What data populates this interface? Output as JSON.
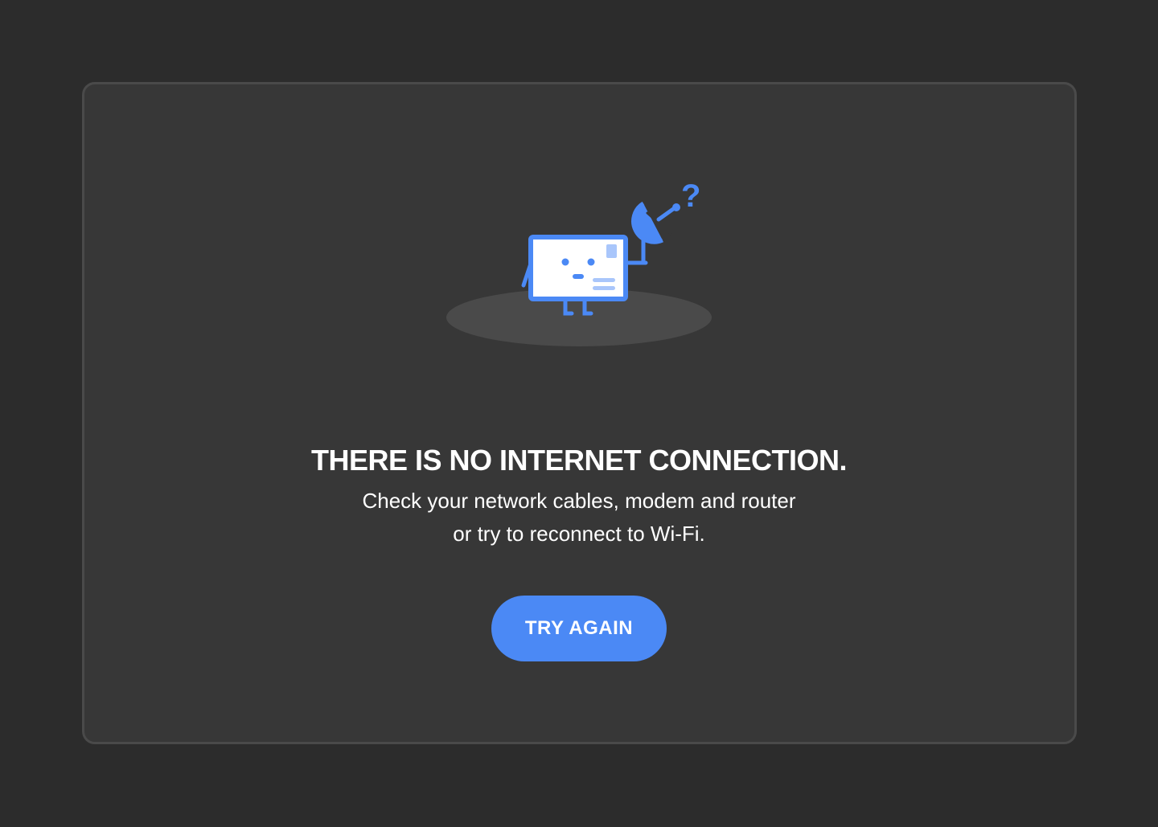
{
  "error": {
    "title": "THERE IS NO INTERNET CONNECTION.",
    "message_line1": "Check your network cables, modem and router",
    "message_line2": "or try to reconnect to Wi-Fi.",
    "button_label": "TRY AGAIN"
  },
  "illustration": {
    "subject": "confused-computer-with-satellite-dish-icon",
    "question_mark": "?"
  },
  "colors": {
    "background": "#2c2c2c",
    "card": "#373737",
    "card_border": "#4a4a4a",
    "accent": "#4b89f5",
    "accent_light": "#a9c6fb",
    "text": "#ffffff",
    "shadow": "#4a4a4a"
  }
}
